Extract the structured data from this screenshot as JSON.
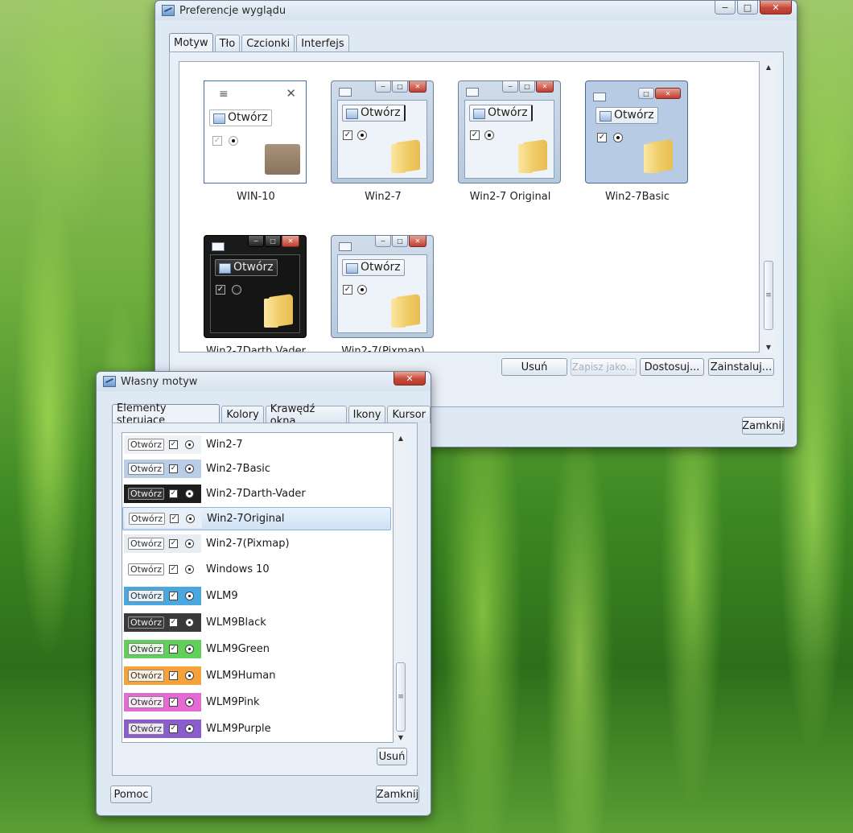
{
  "main_window": {
    "title": "Preferencje wyglądu",
    "tabs": [
      "Motyw",
      "Tło",
      "Czcionki",
      "Interfejs"
    ],
    "themes": [
      {
        "name": "WIN-10",
        "open_label": "Otwórz"
      },
      {
        "name": "Win2-7",
        "open_label": "Otwórz"
      },
      {
        "name": "Win2-7 Original",
        "open_label": "Otwórz"
      },
      {
        "name": "Win2-7Basic",
        "open_label": "Otwórz"
      },
      {
        "name": "Win2-7Darth Vader",
        "open_label": "Otwórz"
      },
      {
        "name": "Win2-7(Pixmap)",
        "open_label": "Otwórz"
      }
    ],
    "buttons": {
      "remove": "Usuń",
      "save_as": "Zapisz jako...",
      "customize": "Dostosuj...",
      "install": "Zainstaluj...",
      "close": "Zamknij"
    }
  },
  "dialog": {
    "title": "Własny motyw",
    "tabs": [
      "Elementy sterujące",
      "Kolory",
      "Krawędź okna",
      "Ikony",
      "Kursor"
    ],
    "swatch_label": "Otwórz",
    "styles": [
      {
        "name": "Win2-7",
        "bg": "#eef2f7",
        "selected": false
      },
      {
        "name": "Win2-7Basic",
        "bg": "#b9cde6",
        "selected": false
      },
      {
        "name": "Win2-7Darth-Vader",
        "bg": "#1d1d1d",
        "selected": false
      },
      {
        "name": "Win2-7Original",
        "bg": "#e9eff6",
        "selected": true
      },
      {
        "name": "Win2-7(Pixmap)",
        "bg": "#e8edf3",
        "selected": false
      },
      {
        "name": "Windows 10",
        "bg": "#ffffff",
        "selected": false
      },
      {
        "name": "WLM9",
        "bg": "#4aa7e0",
        "selected": false
      },
      {
        "name": "WLM9Black",
        "bg": "#3a3a3a",
        "selected": false
      },
      {
        "name": "WLM9Green",
        "bg": "#63cf5b",
        "selected": false
      },
      {
        "name": "WLM9Human",
        "bg": "#f5a23a",
        "selected": false
      },
      {
        "name": "WLM9Pink",
        "bg": "#e66ad3",
        "selected": false
      },
      {
        "name": "WLM9Purple",
        "bg": "#8a5ccc",
        "selected": false
      }
    ],
    "buttons": {
      "remove": "Usuń",
      "help": "Pomoc",
      "close": "Zamknij"
    }
  }
}
